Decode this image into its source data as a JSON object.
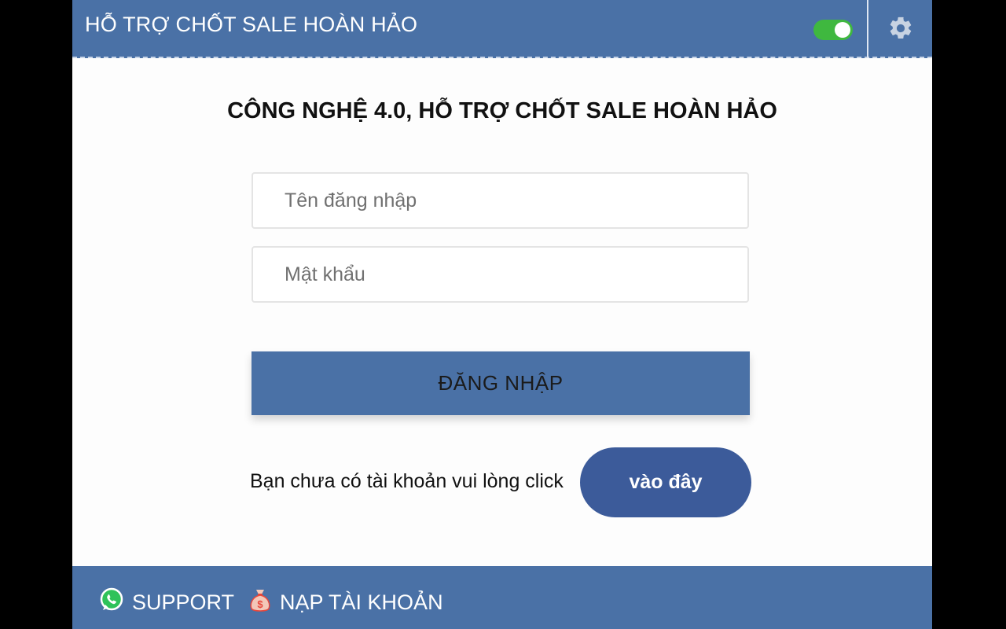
{
  "header": {
    "title": "HỖ TRỢ CHỐT SALE HOÀN HẢO",
    "toggle_state": "on",
    "toggle_color": "#3fb83f",
    "settings_icon": "gear-icon",
    "bg_color": "#4a71a6"
  },
  "main": {
    "title": "CÔNG NGHỆ 4.0, HỖ TRỢ CHỐT SALE HOÀN HẢO",
    "username_placeholder": "Tên đăng nhập",
    "password_placeholder": "Mật khẩu",
    "login_label": "ĐĂNG NHẬP",
    "register_text": "Bạn chưa có tài khoản vui lòng click",
    "register_button": "vào đây"
  },
  "footer": {
    "support_label": "SUPPORT",
    "support_icon": "whatsapp-icon",
    "topup_label": "NẠP TÀI KHOẢN",
    "topup_icon": "money-bag-icon"
  }
}
